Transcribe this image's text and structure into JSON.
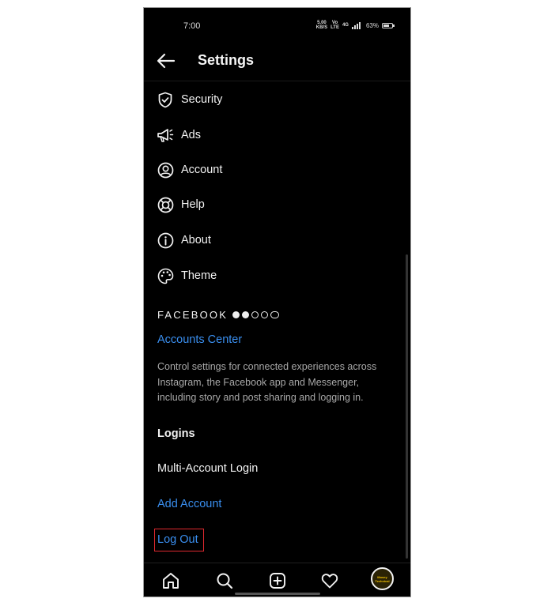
{
  "status": {
    "time": "7:00",
    "net_speed_top": "5.00",
    "net_speed_bottom": "KB/S",
    "volte_top": "Vo",
    "volte_bottom": "LTE",
    "data_top": "4G",
    "battery": "63%"
  },
  "header": {
    "title": "Settings"
  },
  "menu": [
    {
      "label": "Security",
      "icon": "shield-icon"
    },
    {
      "label": "Ads",
      "icon": "megaphone-icon"
    },
    {
      "label": "Account",
      "icon": "account-icon"
    },
    {
      "label": "Help",
      "icon": "lifebuoy-icon"
    },
    {
      "label": "About",
      "icon": "info-icon"
    },
    {
      "label": "Theme",
      "icon": "palette-icon"
    }
  ],
  "facebook": {
    "title": "FACEBOOK",
    "accounts_center": "Accounts Center",
    "description": "Control settings for connected experiences across Instagram, the Facebook app and Messenger, including story and post sharing and logging in."
  },
  "logins": {
    "title": "Logins",
    "multi_account": "Multi-Account Login",
    "add_account": "Add Account",
    "log_out": "Log Out"
  },
  "avatar": {
    "line1": "Mosey",
    "line2": "Technical"
  },
  "colors": {
    "link": "#3a8ff0",
    "highlight_box": "#e0292f",
    "background": "#000000"
  }
}
